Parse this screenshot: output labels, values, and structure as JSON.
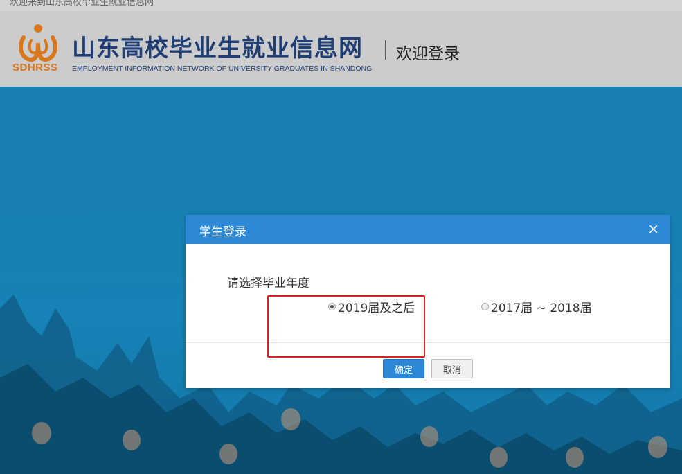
{
  "top_strip": {
    "text": "欢迎来到山东高校毕业生就业信息网"
  },
  "header": {
    "logo_text": "SDHRSS",
    "site_title": "山东高校毕业生就业信息网",
    "site_subtitle": "EMPLOYMENT INFORMATION NETWORK OF UNIVERSITY GRADUATES IN SHANDONG",
    "welcome": "欢迎登录"
  },
  "dialog": {
    "title": "学生登录",
    "close_icon": "×",
    "prompt": "请选择毕业年度",
    "options": [
      {
        "label": "2019届及之后",
        "checked": true
      },
      {
        "label": "2017届 ~ 2018届",
        "checked": false
      }
    ],
    "buttons": {
      "ok": "确定",
      "cancel": "取消"
    }
  },
  "colors": {
    "accent": "#2d89d6",
    "background": "#1585b7",
    "logo_orange": "#d9771d",
    "title_navy": "#1f3f75",
    "highlight": "#e02020"
  }
}
